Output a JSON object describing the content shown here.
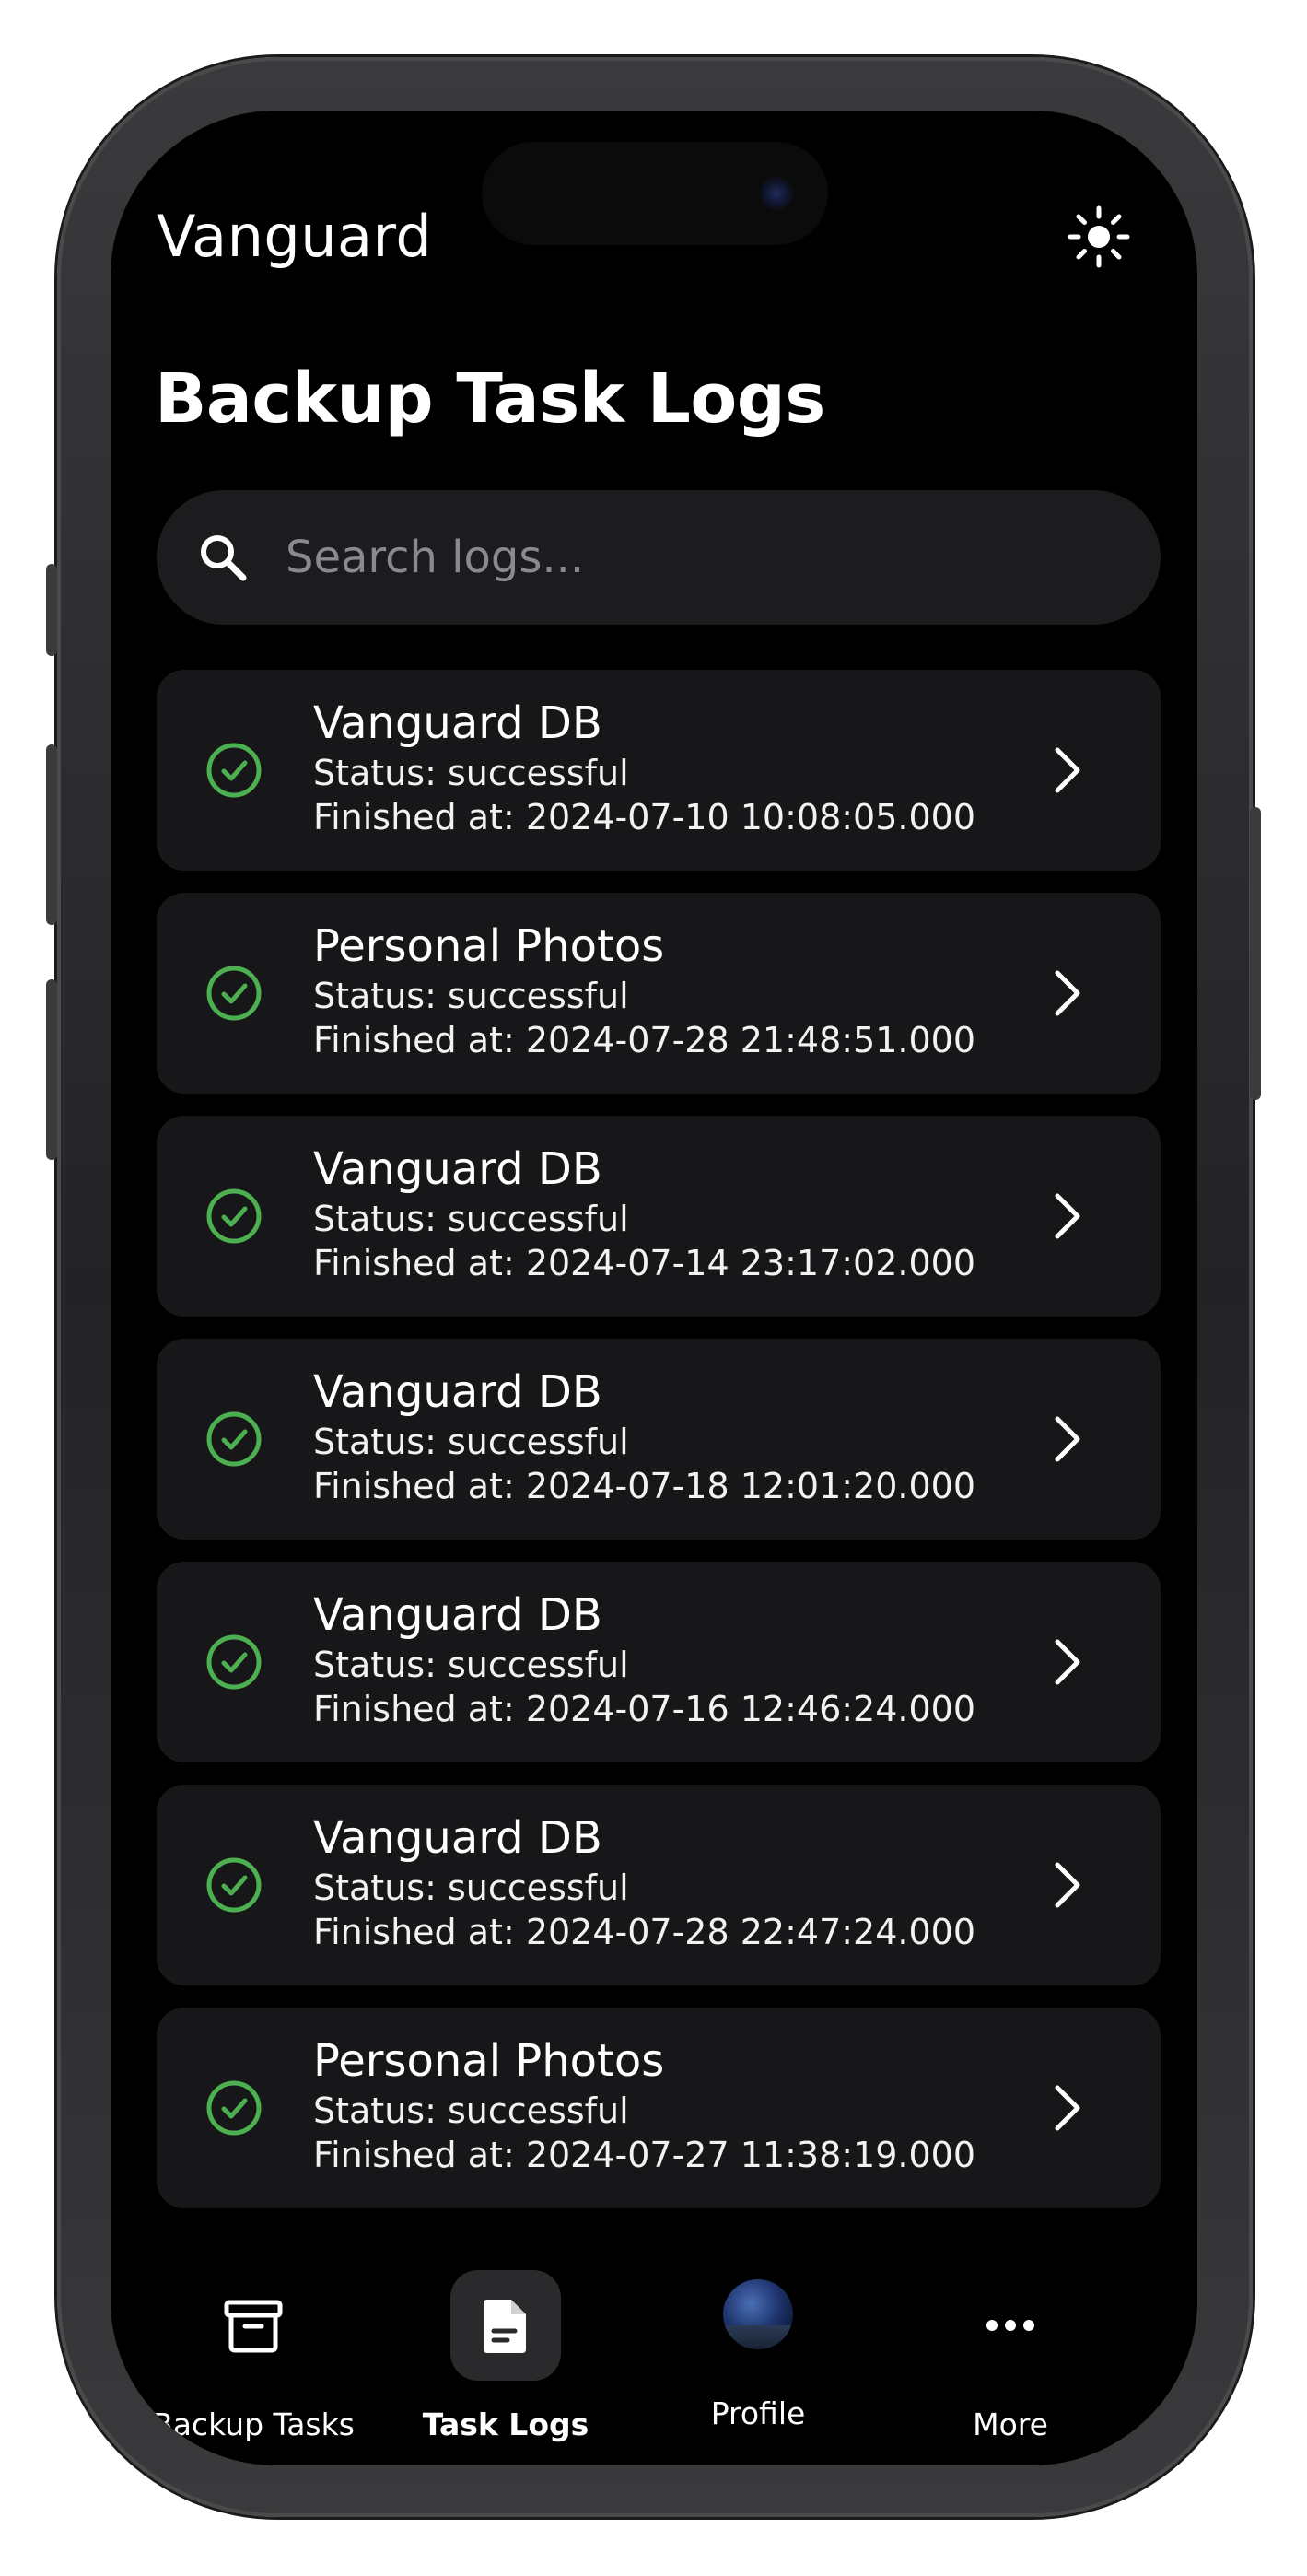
{
  "app": {
    "title": "Vanguard",
    "theme_toggle_icon": "sun-icon"
  },
  "page": {
    "title": "Backup Task Logs"
  },
  "search": {
    "placeholder": "Search logs..."
  },
  "logs": [
    {
      "name": "Vanguard DB",
      "status": "Status: successful",
      "finished": "Finished at: 2024-07-10 10:08:05.000"
    },
    {
      "name": "Personal Photos",
      "status": "Status: successful",
      "finished": "Finished at: 2024-07-28 21:48:51.000"
    },
    {
      "name": "Vanguard DB",
      "status": "Status: successful",
      "finished": "Finished at: 2024-07-14 23:17:02.000"
    },
    {
      "name": "Vanguard DB",
      "status": "Status: successful",
      "finished": "Finished at: 2024-07-18 12:01:20.000"
    },
    {
      "name": "Vanguard DB",
      "status": "Status: successful",
      "finished": "Finished at: 2024-07-16 12:46:24.000"
    },
    {
      "name": "Vanguard DB",
      "status": "Status: successful",
      "finished": "Finished at: 2024-07-28 22:47:24.000"
    },
    {
      "name": "Personal Photos",
      "status": "Status: successful",
      "finished": "Finished at: 2024-07-27 11:38:19.000"
    }
  ],
  "tabs": [
    {
      "label": "Backup Tasks",
      "icon": "archive-box-icon",
      "active": false
    },
    {
      "label": "Task Logs",
      "icon": "document-icon",
      "active": true
    },
    {
      "label": "Profile",
      "icon": "avatar",
      "active": false
    },
    {
      "label": "More",
      "icon": "more-dots-icon",
      "active": false
    }
  ],
  "colors": {
    "background": "#000000",
    "card": "#171719",
    "success": "#4caf50",
    "text": "#ffffff",
    "placeholder": "#8a8a8e"
  }
}
